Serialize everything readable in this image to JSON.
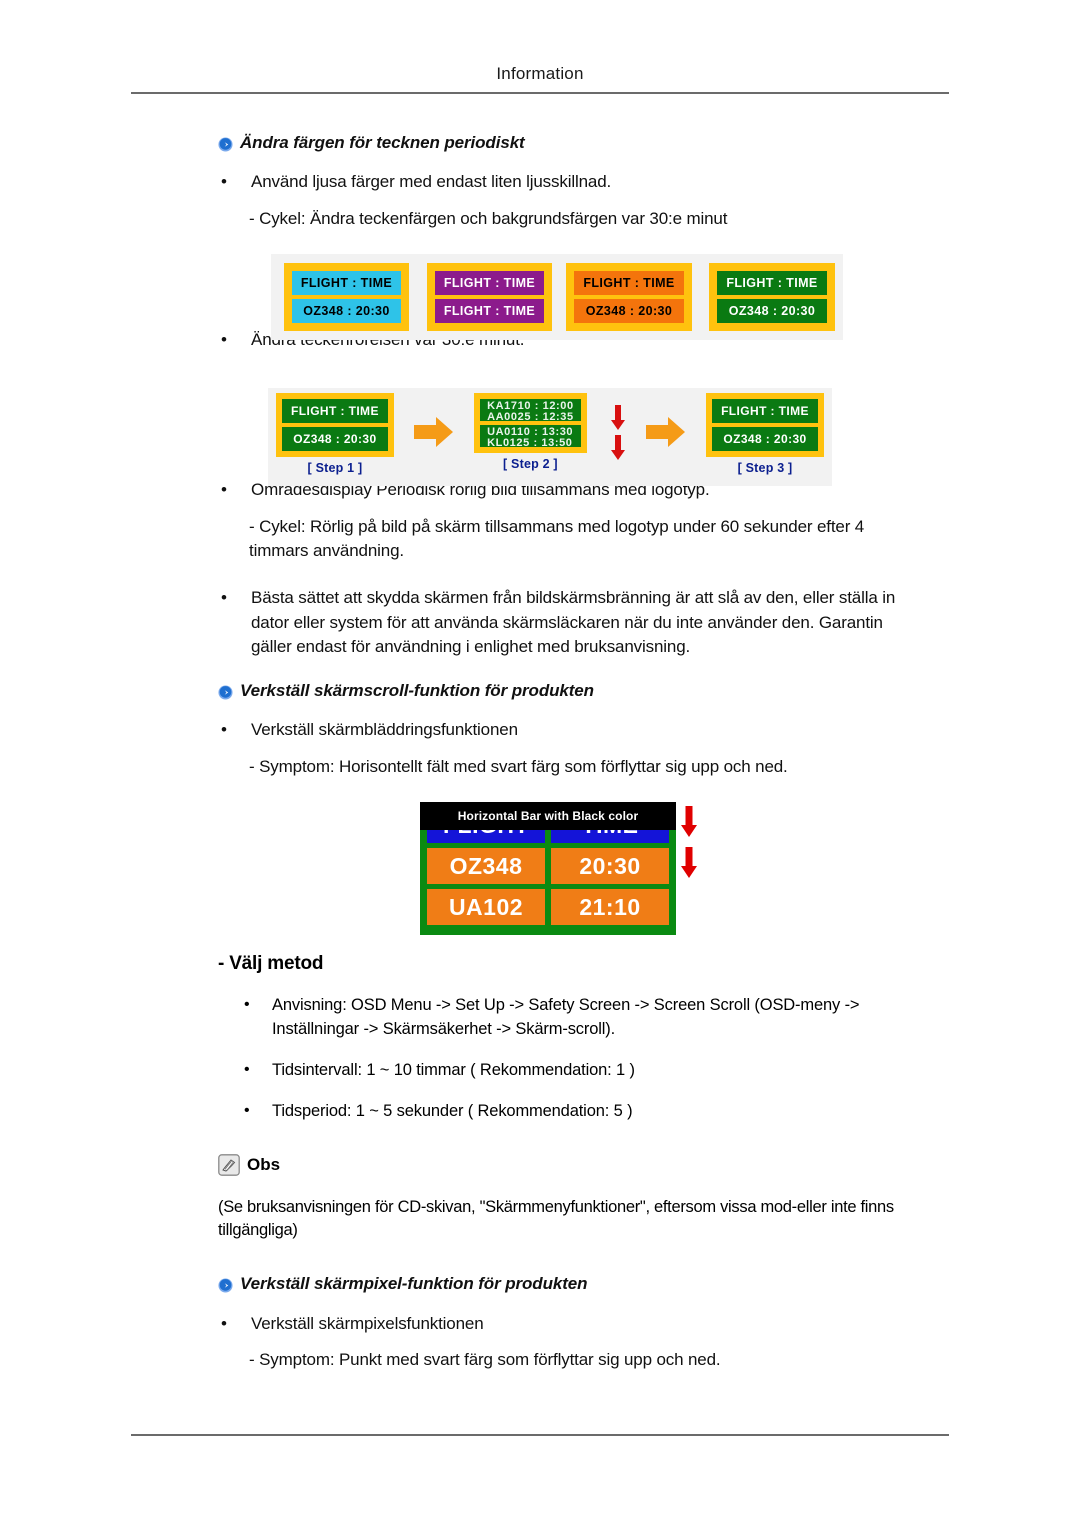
{
  "header": {
    "title": "Information"
  },
  "sections": {
    "color_change": {
      "heading": "Ändra färgen för tecknen periodiskt",
      "bullet1": "Använd ljusa färger med endast liten ljusskillnad.",
      "sub1": "- Cykel: Ändra teckenfärgen och bakgrundsfärgen var 30:e minut",
      "bullet2": "Ändra teckenrörelsen var 30:e minut.",
      "bullet3": "Områdesdisplay Periodisk rörlig bild tillsammans med logotyp.",
      "sub3": "- Cykel: Rörlig på bild på skärm tillsammans med logotyp under 60 sekunder efter 4 timmars användning.",
      "bullet4": "Bästa sättet att skydda skärmen från bildskärmsbränning är att slå av den, eller ställa in dator eller system för att använda skärmsläckaren när du inte använder den. Garantin gäller endast för användning i enlighet med bruksanvisning."
    },
    "screen_scroll": {
      "heading": "Verkställ skärmscroll-funktion för produkten",
      "bullet1": "Verkställ skärmbläddringsfunktionen",
      "sub1": "- Symptom: Horisontellt fält med svart färg som förflyttar sig upp och ned.",
      "method_title": "- Välj metod",
      "method_items": [
        "Anvisning: OSD Menu -> Set Up -> Safety Screen -> Screen Scroll (OSD-meny -> Inställningar -> Skärmsäkerhet -> Skärm-scroll).",
        "Tidsintervall: 1 ~ 10 timmar ( Rekommendation: 1 )",
        "Tidsperiod: 1 ~ 5 sekunder ( Rekommendation: 5 )"
      ]
    },
    "note": {
      "label": "Obs",
      "body": "(Se bruksanvisningen för CD-skivan, \"Skärmmenyfunktioner\", eftersom vissa mod-eller inte finns tillgängliga)"
    },
    "screen_pixel": {
      "heading": "Verkställ skärmpixel-funktion för produkten",
      "bullet1": "Verkställ skärmpixelsfunktionen",
      "sub1": "- Symptom: Punkt med svart färg som förflyttar sig upp och ned."
    }
  },
  "figures": {
    "color_cycle": {
      "panels": [
        {
          "bg": "#2ec3e8",
          "text_color": "#000000",
          "border": "#ffc20e",
          "row1": "FLIGHT :  TIME",
          "row2": "OZ348    :  20:30"
        },
        {
          "bg": "#8c1b8c",
          "text_color": "#ffffff",
          "border": "#ffc20e",
          "row1": "FLIGHT :  TIME",
          "row2": "FLIGHT :  TIME"
        },
        {
          "bg": "#f4740c",
          "text_color": "#000000",
          "border": "#ffc20e",
          "row1": "FLIGHT :  TIME",
          "row2": "OZ348    :  20:30"
        },
        {
          "bg": "#0a7a12",
          "text_color": "#ffffff",
          "border": "#ffc20e",
          "row1": "FLIGHT :  TIME",
          "row2": "OZ348    :  20:30"
        }
      ]
    },
    "steps": {
      "step1": {
        "label": "[ Step 1 ]",
        "row1": "FLIGHT :  TIME",
        "row2": "OZ348    :  20:30"
      },
      "step2": {
        "label": "[ Step 2 ]",
        "row1a": "KA1710  :  12:00",
        "row1b": "AA0025  :  12:35",
        "row2a": "UA0110  :  13:30",
        "row2b": "KL0125  :  13:50"
      },
      "step3": {
        "label": "[ Step 3 ]",
        "row1": "FLIGHT :  TIME",
        "row2": "OZ348    :  20:30"
      }
    },
    "horizontal_bar": {
      "caption": "Horizontal Bar with Black color",
      "rows": [
        {
          "left": "FLIGHT",
          "right": "TIME",
          "color": "#1414d8"
        },
        {
          "left": "OZ348",
          "right": "20:30",
          "color": "#f07d16"
        },
        {
          "left": "UA102",
          "right": "21:10",
          "color": "#f07d16"
        }
      ],
      "board_bg": "#0a8a12"
    }
  },
  "colors": {
    "panel_border": "#ffc20e",
    "green": "#0a7a12",
    "blue_link": "#2e7fe0",
    "step_label": "#0b1f8f",
    "red_arrow": "#d81010",
    "orange_arrow": "#f59b17",
    "rule": "#6b6b6b"
  },
  "icons": {
    "arrow_bullet": "blue-circle-right-arrow-icon",
    "note": "note-pencil-icon",
    "down_arrow": "red-down-arrow-icon",
    "right_arrow": "orange-right-arrow-icon"
  }
}
